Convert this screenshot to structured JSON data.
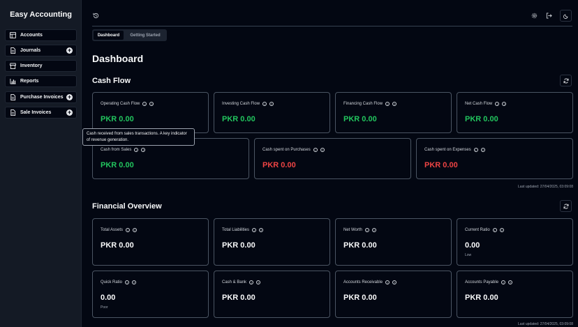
{
  "app": {
    "title": "Easy Accounting"
  },
  "sidebar": {
    "items": [
      {
        "label": "Accounts",
        "icon": "table-icon",
        "has_add": false
      },
      {
        "label": "Journals",
        "icon": "file-text-icon",
        "has_add": true
      },
      {
        "label": "Inventory",
        "icon": "store-icon",
        "has_add": false
      },
      {
        "label": "Reports",
        "icon": "bar-chart-icon",
        "has_add": false
      },
      {
        "label": "Purchase Invoices",
        "icon": "document-icon",
        "has_add": true
      },
      {
        "label": "Sale Invoices",
        "icon": "document-icon",
        "has_add": true
      }
    ],
    "add_symbol": "+"
  },
  "header": {
    "history_icon": "history-icon",
    "settings_icon": "gear-icon",
    "logout_icon": "logout-icon",
    "theme_icon": "moon-icon"
  },
  "tabs": [
    {
      "label": "Dashboard",
      "active": true
    },
    {
      "label": "Getting Started",
      "active": false
    }
  ],
  "main": {
    "page_title": "Dashboard",
    "cash_flow": {
      "title": "Cash Flow",
      "row1": [
        {
          "label": "Operating Cash Flow",
          "value": "PKR 0.00",
          "tone": "positive"
        },
        {
          "label": "Investing Cash Flow",
          "value": "PKR 0.00",
          "tone": "positive"
        },
        {
          "label": "Financing Cash Flow",
          "value": "PKR 0.00",
          "tone": "positive"
        },
        {
          "label": "Net Cash Flow",
          "value": "PKR 0.00",
          "tone": "positive"
        }
      ],
      "row2": [
        {
          "label": "Cash from Sales",
          "value": "PKR 0.00",
          "tone": "positive"
        },
        {
          "label": "Cash spent on Purchases",
          "value": "PKR 0.00",
          "tone": "negative"
        },
        {
          "label": "Cash spent on Expenses",
          "value": "PKR 0.00",
          "tone": "negative"
        }
      ],
      "last_updated": "Last updated: 27/04/2025, 03:09:08"
    },
    "financial_overview": {
      "title": "Financial Overview",
      "row1": [
        {
          "label": "Total Assets",
          "value": "PKR 0.00",
          "sub": ""
        },
        {
          "label": "Total Liabilities",
          "value": "PKR 0.00",
          "sub": ""
        },
        {
          "label": "Net Worth",
          "value": "PKR 0.00",
          "sub": ""
        },
        {
          "label": "Current Ratio",
          "value": "0.00",
          "sub": "Low"
        }
      ],
      "row2": [
        {
          "label": "Quick Ratio",
          "value": "0.00",
          "sub": "Poor"
        },
        {
          "label": "Cash & Bank",
          "value": "PKR 0.00",
          "sub": ""
        },
        {
          "label": "Accounts Receivable",
          "value": "PKR 0.00",
          "sub": ""
        },
        {
          "label": "Accounts Payable",
          "value": "PKR 0.00",
          "sub": ""
        }
      ],
      "last_updated": "Last updated: 27/04/2025, 03:09:08"
    },
    "tooltip": "Cash received from sales transactions. A key indicator of revenue generation."
  },
  "colors": {
    "positive": "#22c55e",
    "negative": "#ef4444",
    "background": "#030712",
    "sidebar": "#141a25"
  }
}
